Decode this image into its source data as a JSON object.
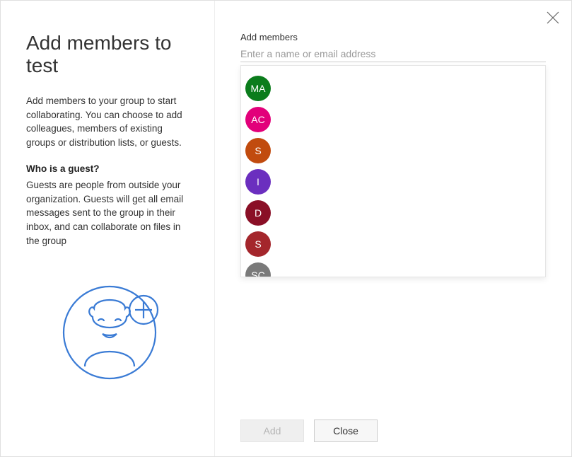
{
  "header": {
    "title": "Add members to test"
  },
  "left": {
    "description": "Add members to your group to start collaborating. You can choose to add colleagues, members of existing groups or distribution lists, or guests.",
    "guest_heading": "Who is a guest?",
    "guest_description": "Guests are people from outside your organization. Guests will get all email messages sent to the group in their inbox, and can collaborate on files in the group"
  },
  "search": {
    "label": "Add members",
    "placeholder": "Enter a name or email address"
  },
  "suggestions": [
    {
      "initials": "MA",
      "color": "#0b7c1c"
    },
    {
      "initials": "AC",
      "color": "#e2007a"
    },
    {
      "initials": "S",
      "color": "#c14b0e"
    },
    {
      "initials": "I",
      "color": "#6b2fbf"
    },
    {
      "initials": "D",
      "color": "#8a0f26"
    },
    {
      "initials": "S",
      "color": "#a4262c"
    },
    {
      "initials": "SC",
      "color": "#7a7a7a"
    }
  ],
  "buttons": {
    "add": "Add",
    "close": "Close"
  }
}
